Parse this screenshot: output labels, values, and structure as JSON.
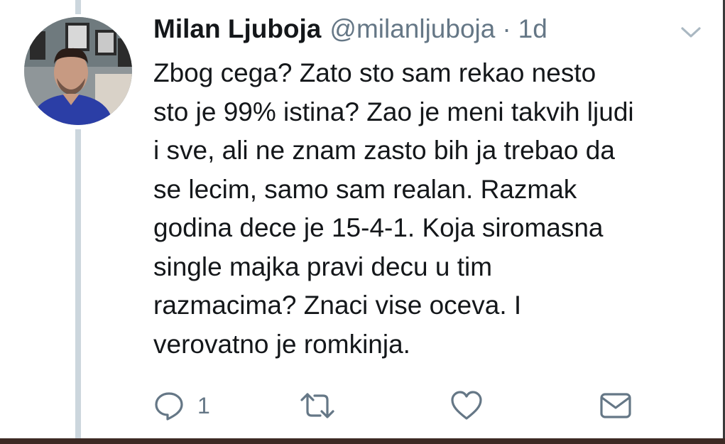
{
  "tweet": {
    "author_name": "Milan Ljuboja",
    "author_handle": "@milanljuboja",
    "separator": "·",
    "timestamp": "1d",
    "text_lines": [
      "Zbog cega? Zato sto sam rekao nesto",
      "sto je 99% istina? Zao je meni takvih ljudi",
      "i sve, ali ne znam zasto bih ja trebao da",
      "se lecim, samo sam realan. Razmak",
      "godina dece je 15-4-1. Koja siromasna",
      "single majka pravi decu u tim",
      "razmacima? Znaci vise oceva. I",
      "verovatno je romkinja."
    ],
    "reply_count": "1"
  },
  "icons": {
    "menu": "chevron-down-icon",
    "reply": "reply-bubble-icon",
    "retweet": "retweet-icon",
    "like": "heart-icon",
    "message": "envelope-icon"
  },
  "colors": {
    "text": "#14171a",
    "secondary": "#657786",
    "thread_line": "#ccd6dd"
  }
}
